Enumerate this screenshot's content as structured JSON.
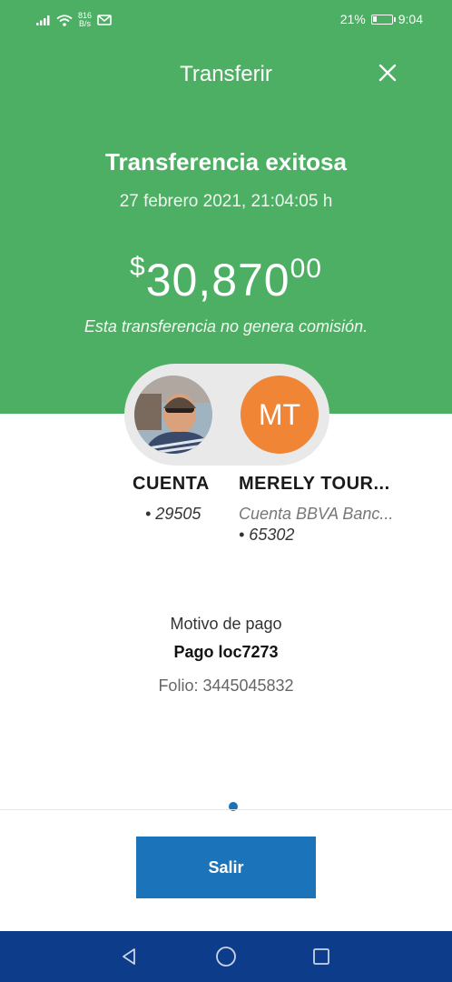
{
  "status_bar": {
    "net_speed_value": "816",
    "net_speed_unit": "B/s",
    "battery": "21%",
    "battery_level": 0.21,
    "time": "9:04"
  },
  "header": {
    "title": "Transferir"
  },
  "transfer": {
    "status": "Transferencia exitosa",
    "datetime": "27 febrero 2021, 21:04:05 h",
    "currency_symbol": "$",
    "amount_main": "30,870",
    "amount_cents": "00",
    "note": "Esta transferencia no genera comisión."
  },
  "sender": {
    "name": "CUENTA",
    "account": "• 29505"
  },
  "recipient": {
    "initials": "MT",
    "name": "MERELY TOUR...",
    "bank": "Cuenta BBVA Banc...",
    "account": "• 65302"
  },
  "details": {
    "motivo_label": "Motivo de pago",
    "motivo_value": "Pago loc7273",
    "folio": "Folio: 3445045832"
  },
  "actions": {
    "exit_label": "Salir"
  },
  "colors": {
    "header_green": "#4caf63",
    "primary_blue": "#1b73ba",
    "recipient_avatar": "#f08535",
    "navbar": "#0d3d8a"
  }
}
